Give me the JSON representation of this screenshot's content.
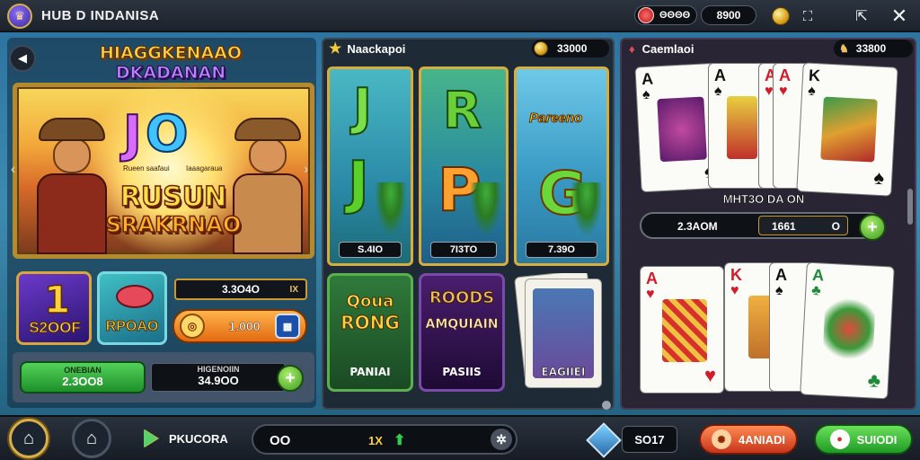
{
  "header": {
    "title": "HUB D INDANISA",
    "coins_label": "ΘΘΘΘ",
    "coins_value": "8900"
  },
  "left": {
    "logo_line1": "HIAGGKENAAO",
    "logo_line2": "DKADANAN",
    "hero_letters_j": "J",
    "hero_letters_o": "O",
    "hero_small_left": "Rueen saafaui",
    "hero_small_right": "Iaaagaraua",
    "hero_title_1": "RUSUN",
    "hero_title_2": "SRAKRNAO",
    "tile_a_num": "1",
    "tile_a_label": "S2OOF",
    "tile_b_label": "RPOAO",
    "value_box": "3.3O4O",
    "value_box_suffix": "IX",
    "orange_value": "1.000",
    "green_small": "ONEBIAN",
    "green_value": "2.3OO8",
    "dark_small": "HIGENOIIN",
    "dark_value": "34.9OO"
  },
  "middle": {
    "title": "Naackapoi",
    "balance": "33000",
    "slots": [
      {
        "letter_top": "J",
        "letter_bottom": "J",
        "value": "S.4IO"
      },
      {
        "letter_top": "R",
        "letter_bottom": "P",
        "value": "7I3TO"
      },
      {
        "label": "Pareeno",
        "letter_bottom": "G",
        "value": "7.39O"
      }
    ],
    "cards": [
      {
        "title_1": "Qoua",
        "title_2": "RONG",
        "bottom": "PANIAI"
      },
      {
        "title_1": "ROODS",
        "title_2": "AMQUIAIN",
        "bottom": "PASIIS"
      },
      {
        "bottom": "EAGIIEI"
      }
    ]
  },
  "right": {
    "title": "Caemlaoi",
    "balance": "33800",
    "multiplier_label": "MHT3O DA ON",
    "bet_amount": "2.3AOM",
    "bet_value_1": "1661",
    "bet_value_2": "O",
    "cards_top": [
      {
        "rank": "A",
        "suit": "♠",
        "color": "black"
      },
      {
        "rank": "A",
        "suit": "♠",
        "color": "black"
      },
      {
        "rank": "A",
        "suit": "♥",
        "color": "red"
      },
      {
        "rank": "A",
        "suit": "♥",
        "color": "red"
      },
      {
        "rank": "K",
        "suit": "♠",
        "color": "black"
      }
    ],
    "cards_bottom": [
      {
        "rank": "A",
        "suit": "♥",
        "color": "red"
      },
      {
        "rank": "K",
        "suit": "♥",
        "color": "red"
      },
      {
        "rank": "A",
        "suit": "♠",
        "color": "black"
      },
      {
        "rank": "A",
        "suit": "♣",
        "color": "black"
      }
    ]
  },
  "nav": {
    "play_label": "PKUCORA",
    "center_left": "OO",
    "center_mult": "1X",
    "small_pill": "SO17",
    "red_button": "4ANIADI",
    "green_button": "SUIODI"
  },
  "colors": {
    "accent_gold": "#d6ad3e",
    "green_button": "#1f9a24",
    "orange_button": "#e36a12",
    "red_button": "#c8341a"
  }
}
